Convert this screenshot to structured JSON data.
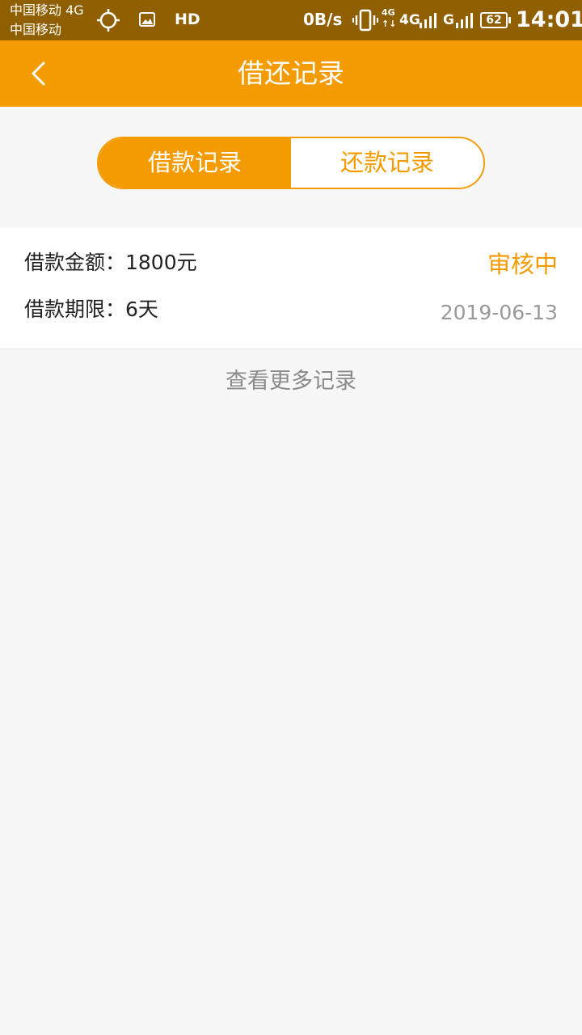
{
  "status_bar": {
    "carrier_line1": "中国移动 4G",
    "carrier_line2": "中国移动",
    "hd": "HD",
    "net_speed": "0B/s",
    "net_small": "4G",
    "net_arrows": "↑↓",
    "net_type1": "4G",
    "net_type2": "G",
    "battery": "62",
    "time": "14:01",
    "icons": [
      "location-icon",
      "image-icon",
      "vibrate-icon",
      "signal-icon",
      "battery-icon"
    ]
  },
  "header": {
    "title": "借还记录",
    "back_icon": "chevron-left-icon"
  },
  "tabs": [
    {
      "label": "借款记录",
      "active": true
    },
    {
      "label": "还款记录",
      "active": false
    }
  ],
  "record": {
    "amount": "借款金额：1800元",
    "term": "借款期限：6天",
    "status": "审核中",
    "date": "2019-06-13"
  },
  "more_link": "查看更多记录",
  "colors": {
    "accent": "#f39b00",
    "status_bar": "#8f5f00",
    "background": "#f7f7f7",
    "muted_text": "#999999"
  }
}
